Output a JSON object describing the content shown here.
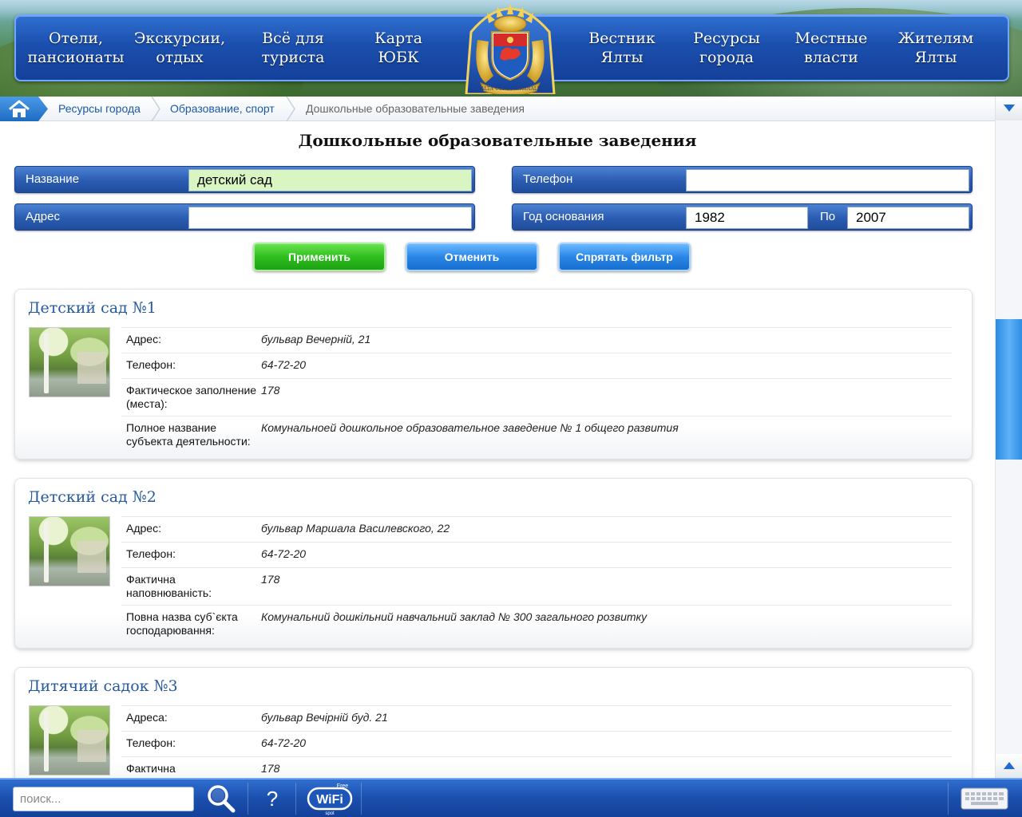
{
  "nav": {
    "items": [
      {
        "label": "Отели,\nпансионаты"
      },
      {
        "label": "Экскурсии,\nотдых"
      },
      {
        "label": "Всё для\nтуриста"
      },
      {
        "label": "Карта\nЮБК"
      },
      {
        "label": "Вестник\nЯлты"
      },
      {
        "label": "Ресурсы\nгорода"
      },
      {
        "label": "Местные\nвласти"
      },
      {
        "label": "Жителям\nЯлты"
      }
    ],
    "crest_motto": "YALTA URBS MERIDIALIS"
  },
  "breadcrumb": {
    "items": [
      "Ресурсы города",
      "Образование, спорт"
    ],
    "current": "Дошкольные образовательные заведения"
  },
  "page_title": "Дошкольные образовательные заведения",
  "filter": {
    "name_label": "Название",
    "name_value": "детский сад",
    "phone_label": "Телефон",
    "phone_value": "",
    "address_label": "Адрес",
    "address_value": "",
    "year_label": "Год основания",
    "year_from": "1982",
    "year_to_label": "По",
    "year_to": "2007",
    "apply_label": "Применить",
    "cancel_label": "Отменить",
    "hide_label": "Спрятать фильтр"
  },
  "results": [
    {
      "title": "Детский сад №1",
      "fields": [
        {
          "label": "Адрес:",
          "value": "бульвар Вечерній, 21"
        },
        {
          "label": "Телефон:",
          "value": "64-72-20"
        },
        {
          "label": "Фактическое заполнение (места):",
          "value": "178"
        },
        {
          "label": "Полное название субъекта деятельности:",
          "value": "Комунальноей дошкольное образовательное заведение № 1 общего развития"
        }
      ]
    },
    {
      "title": "Детский сад №2",
      "fields": [
        {
          "label": "Адрес:",
          "value": "бульвар Маршала Василевского, 22"
        },
        {
          "label": "Телефон:",
          "value": "64-72-20"
        },
        {
          "label": "Фактична наповнюваність:",
          "value": "178"
        },
        {
          "label": "Повна назва суб`єкта господарювання:",
          "value": "Комунальний дошкільний навчальний заклад № 300 загального розвитку"
        }
      ]
    },
    {
      "title": "Дитячий садок №3",
      "fields": [
        {
          "label": "Адреса:",
          "value": "бульвар Вечірній буд. 21"
        },
        {
          "label": "Телефон:",
          "value": "64-72-20"
        },
        {
          "label": "Фактична",
          "value": "178"
        }
      ]
    }
  ],
  "bottombar": {
    "search_placeholder": "поиск...",
    "help_label": "?",
    "wifi_label": "WiFi",
    "wifi_top": "Free",
    "wifi_bottom": "spot"
  },
  "colors": {
    "nav_blue": "#1b4fae",
    "apply_green": "#2fbf1e",
    "button_blue": "#2a86e6",
    "title_blue": "#25589c",
    "name_field_fill": "#d8f5c2"
  }
}
